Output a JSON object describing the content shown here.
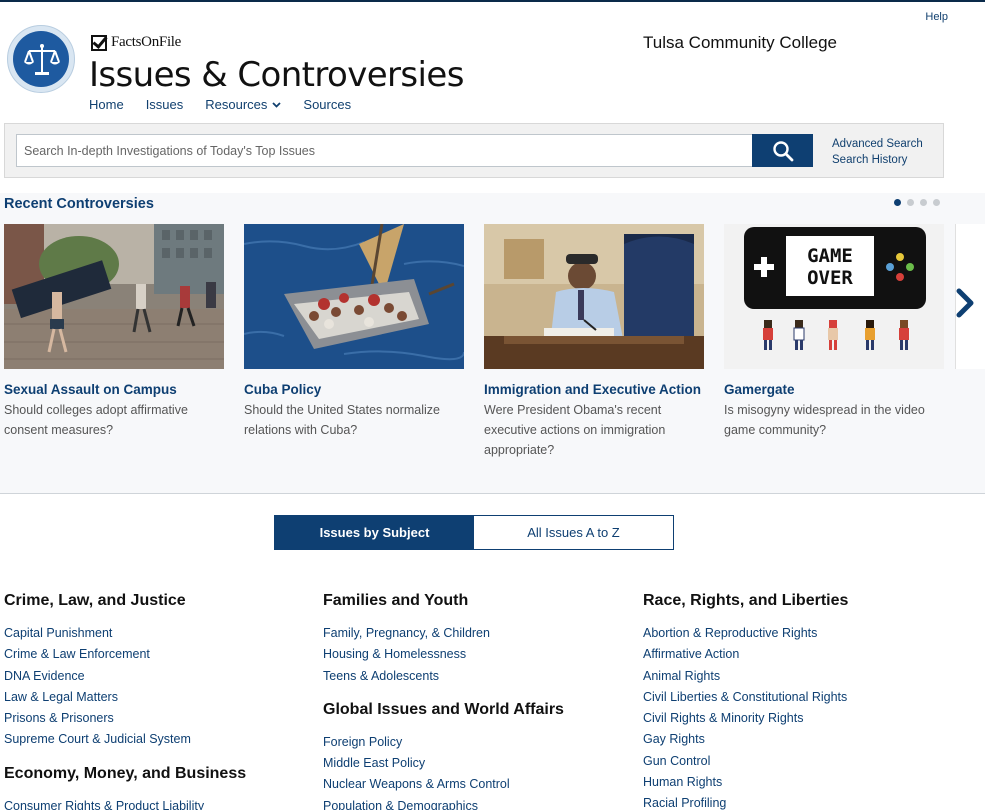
{
  "header": {
    "help_label": "Help",
    "brand_label": "FactsOnFile",
    "site_title": "Issues & Controversies",
    "institution": "Tulsa Community College",
    "nav": [
      {
        "label": "Home"
      },
      {
        "label": "Issues"
      },
      {
        "label": "Resources"
      },
      {
        "label": "Sources"
      }
    ]
  },
  "search": {
    "placeholder": "Search In-depth Investigations of Today's Top Issues",
    "value": "",
    "advanced_label": "Advanced Search",
    "history_label": "Search History",
    "icon": "search-icon"
  },
  "recent": {
    "title": "Recent Controversies",
    "dots": 4,
    "active_dot": 0,
    "cards": [
      {
        "title": "Sexual Assault on Campus",
        "subtitle": "Should colleges adopt affirmative consent measures?"
      },
      {
        "title": "Cuba Policy",
        "subtitle": "Should the United States normalize relations with Cuba?"
      },
      {
        "title": "Immigration and Executive Action",
        "subtitle": "Were President Obama's recent executive actions on immigration appropriate?"
      },
      {
        "title": "Gamergate",
        "subtitle": "Is misogyny widespread in the video game community?"
      }
    ],
    "gameover_text": "GAME OVER"
  },
  "tabs": [
    {
      "label": "Issues by Subject",
      "active": true
    },
    {
      "label": "All Issues A to Z",
      "active": false
    }
  ],
  "subjects": {
    "col1": {
      "groups": [
        {
          "heading": "Crime, Law, and Justice",
          "items": [
            "Capital Punishment",
            "Crime & Law Enforcement",
            "DNA Evidence",
            "Law & Legal Matters",
            "Prisons & Prisoners",
            "Supreme Court & Judicial System"
          ]
        },
        {
          "heading": "Economy, Money, and Business",
          "items": [
            "Consumer Rights & Product Liability"
          ]
        }
      ]
    },
    "col2": {
      "groups": [
        {
          "heading": "Families and Youth",
          "items": [
            "Family, Pregnancy, & Children",
            "Housing & Homelessness",
            "Teens & Adolescents"
          ]
        },
        {
          "heading": "Global Issues and World Affairs",
          "items": [
            "Foreign Policy",
            "Middle East Policy",
            "Nuclear Weapons & Arms Control",
            "Population & Demographics"
          ]
        }
      ]
    },
    "col3": {
      "groups": [
        {
          "heading": "Race, Rights, and Liberties",
          "items": [
            "Abortion & Reproductive Rights",
            "Affirmative Action",
            "Animal Rights",
            "Civil Liberties & Constitutional Rights",
            "Civil Rights & Minority Rights",
            "Gay Rights",
            "Gun Control",
            "Human Rights",
            "Racial Profiling"
          ]
        }
      ]
    }
  },
  "colors": {
    "brand": "#0e3f72",
    "link": "#0e3f72",
    "logo": "#1e5aa0"
  }
}
